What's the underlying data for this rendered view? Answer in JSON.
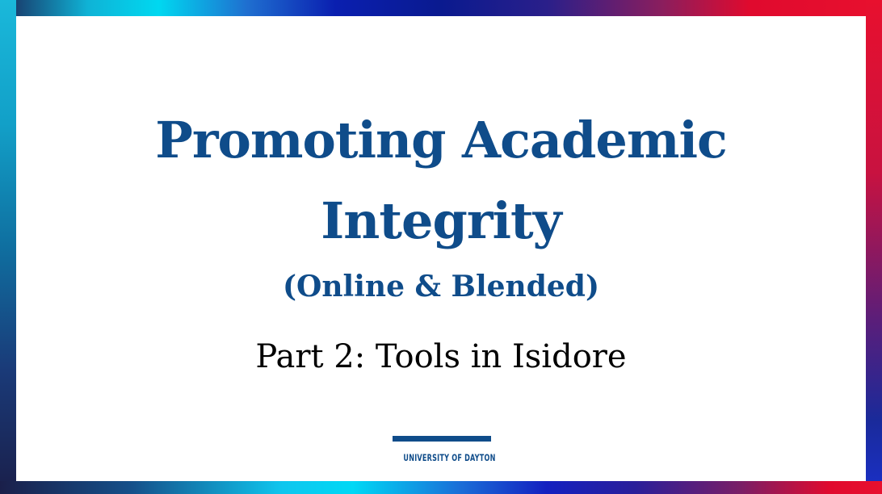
{
  "slide": {
    "title_lines": [
      "Promoting Academic",
      "Integrity"
    ],
    "subtitle": "(Online & Blended)",
    "part": "Part 2: Tools in Isidore",
    "logo_text": "UNIVERSITY OF DAYTON"
  },
  "colors": {
    "title": "#0f4c8a",
    "body_text": "#000000",
    "frame_start": "#00d8f0",
    "frame_end": "#e8102e"
  }
}
